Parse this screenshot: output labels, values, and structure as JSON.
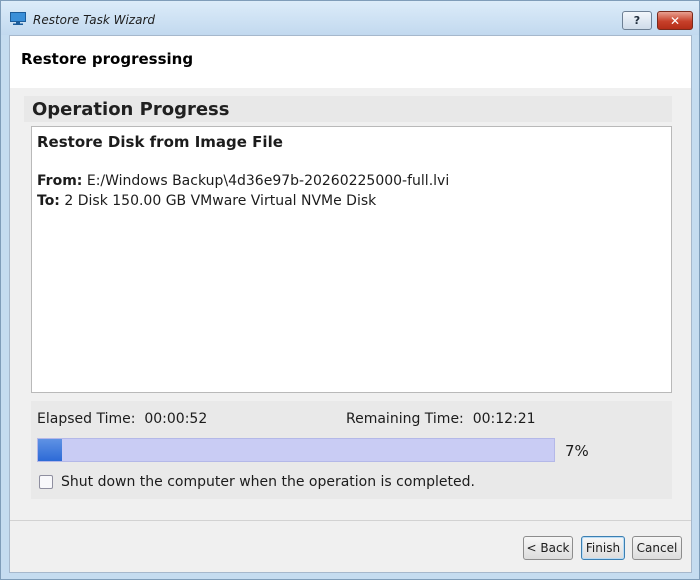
{
  "window": {
    "title": "Restore Task Wizard",
    "help_label": "?",
    "close_label": "✕"
  },
  "page": {
    "title": "Restore progressing"
  },
  "operation": {
    "section_title": "Operation Progress",
    "task_title": "Restore Disk from Image File",
    "from_label": "From:",
    "from_value": "E:/Windows Backup\\4d36e97b-20260225000-full.lvi",
    "to_label": "To:",
    "to_value": "2 Disk 150.00 GB VMware Virtual NVMe Disk"
  },
  "status": {
    "elapsed_label": "Elapsed Time:",
    "elapsed_value": "00:00:52",
    "remaining_label": "Remaining Time:",
    "remaining_value": "00:12:21",
    "progress_percent": 7,
    "progress_text": "7%",
    "shutdown_label": "Shut down the computer when the operation is completed.",
    "shutdown_checked": false
  },
  "footer": {
    "back_label": "< Back",
    "finish_label": "Finish",
    "cancel_label": "Cancel"
  },
  "colors": {
    "progress_fill": "#2d6ad6",
    "progress_track": "#c9ccf4"
  }
}
